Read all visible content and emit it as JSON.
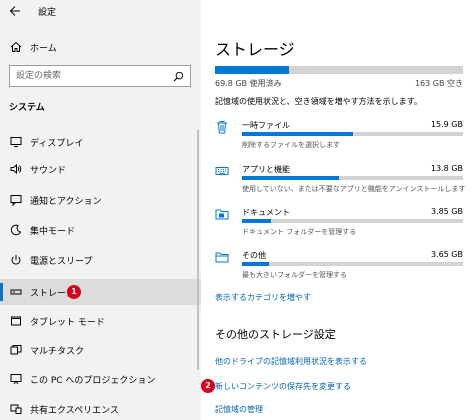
{
  "window": {
    "title": "設定",
    "minimize_glyph": "—",
    "maximize_glyph": "☐",
    "close_glyph": "✕"
  },
  "sidebar": {
    "home_label": "ホーム",
    "search_placeholder": "設定の検索",
    "section_title": "システム",
    "items": [
      {
        "label": "ディスプレイ",
        "icon": "display-icon"
      },
      {
        "label": "サウンド",
        "icon": "sound-icon"
      },
      {
        "label": "通知とアクション",
        "icon": "notification-icon"
      },
      {
        "label": "集中モード",
        "icon": "focus-assist-icon"
      },
      {
        "label": "電源とスリープ",
        "icon": "power-icon"
      },
      {
        "label": "ストレージ",
        "icon": "storage-icon",
        "selected": true
      },
      {
        "label": "タブレット モード",
        "icon": "tablet-mode-icon"
      },
      {
        "label": "マルチタスク",
        "icon": "multitasking-icon"
      },
      {
        "label": "この PC へのプロジェクション",
        "icon": "projection-icon"
      },
      {
        "label": "共有エクスペリエンス",
        "icon": "shared-experiences-icon"
      }
    ]
  },
  "annotations": {
    "badge1": "1",
    "badge2": "2"
  },
  "main": {
    "title": "ストレージ",
    "total": {
      "used": "69.8 GB 使用済み",
      "size": "163 GB 空き",
      "used_fraction": 0.3
    },
    "description": "記憶域の使用状況と、空き領域を増やす方法を示します。",
    "categories": [
      {
        "name": "一時ファイル",
        "size": "15.9 GB",
        "desc": "削除するファイルを選択します",
        "fraction": 0.5,
        "icon": "trash-icon"
      },
      {
        "name": "アプリと機能",
        "size": "13.8 GB",
        "desc": "使用していない、または不要なアプリと機能をアンインストールします",
        "fraction": 0.44,
        "icon": "keyboard-icon"
      },
      {
        "name": "ドキュメント",
        "size": "3.85 GB",
        "desc": "ドキュメント フォルダーを管理する",
        "fraction": 0.13,
        "icon": "document-folder-icon"
      },
      {
        "name": "その他",
        "size": "3.65 GB",
        "desc": "最も大きいフォルダーを管理する",
        "fraction": 0.12,
        "icon": "other-folder-icon"
      }
    ],
    "more_categories_link": "表示するカテゴリを増やす",
    "other_settings_title": "その他のストレージ設定",
    "links": [
      "他のドライブの記憶域利用状況を表示する",
      "新しいコンテンツの保存先を変更する",
      "記憶域の管理"
    ]
  },
  "colors": {
    "accent": "#0078d7",
    "badge": "#d9001e",
    "link": "#0063b1"
  }
}
